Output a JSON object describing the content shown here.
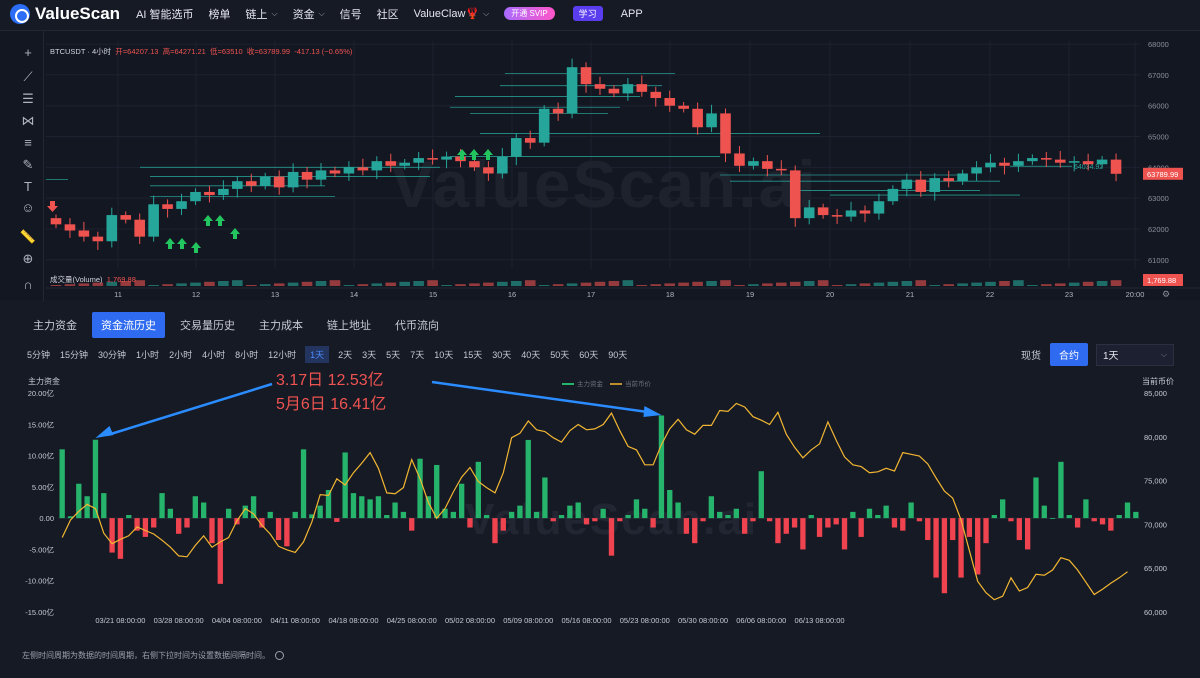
{
  "nav": {
    "brand": "ValueScan",
    "items": [
      "AI 智能选币",
      "榜单",
      "链上",
      "资金",
      "信号",
      "社区",
      "ValueClaw🦞"
    ],
    "vip_label": "开通 SVIP",
    "study_label": "学习",
    "app_label": "APP"
  },
  "kline": {
    "symbol": "BTCUSDT · 4小时",
    "open": "开=64207.13",
    "high": "高=64271.21",
    "low": "低=63510",
    "close": "收=63789.99",
    "change": "-417.13 (−0.65%)",
    "volume_label": "成交量(Volume)",
    "volume_value": "1,769.88",
    "price_ticks": [
      "68000",
      "67000",
      "66000",
      "65000",
      "64000",
      "63000",
      "62000",
      "61000"
    ],
    "date_ticks": [
      "11",
      "12",
      "13",
      "14",
      "15",
      "16",
      "17",
      "18",
      "19",
      "20",
      "21",
      "22",
      "23",
      "20:00"
    ],
    "last_price": "63789.99",
    "line_price": "64034.92",
    "watermark": "ValueScan.ai",
    "closes": [
      62150,
      61950,
      61750,
      61600,
      62450,
      62300,
      61750,
      62800,
      62650,
      62900,
      63200,
      63100,
      63300,
      63550,
      63400,
      63700,
      63350,
      63850,
      63600,
      63900,
      63800,
      64000,
      63900,
      64200,
      64050,
      64150,
      64300,
      64250,
      64350,
      64200,
      64000,
      63800,
      64350,
      64950,
      64800,
      65900,
      65750,
      67250,
      66700,
      66550,
      66400,
      66700,
      66450,
      66250,
      66000,
      65900,
      65300,
      65750,
      64450,
      64050,
      64200,
      63950,
      63900,
      62350,
      62700,
      62450,
      62400,
      62600,
      62500,
      62900,
      63300,
      63600,
      63200,
      63650,
      63550,
      63800,
      64000,
      64150,
      64050,
      64200,
      64300,
      64250,
      64150,
      64200,
      64100,
      64250,
      63790
    ],
    "colors": {
      "up": "#26a69a",
      "down": "#ef5350",
      "green": "#22c55e"
    }
  },
  "tabs": [
    "主力资金",
    "资金流历史",
    "交易量历史",
    "主力成本",
    "链上地址",
    "代币流向"
  ],
  "active_tab": 1,
  "intervals": [
    "5分钟",
    "15分钟",
    "30分钟",
    "1小时",
    "2小时",
    "4小时",
    "8小时",
    "12小时",
    "1天",
    "2天",
    "3天",
    "5天",
    "7天",
    "10天",
    "15天",
    "30天",
    "40天",
    "50天",
    "60天",
    "90天"
  ],
  "active_interval": 8,
  "market_types": [
    "现货",
    "合约"
  ],
  "active_market": 1,
  "period_select": "1天",
  "flow": {
    "left_title": "主力资金",
    "right_title": "当前币价",
    "legend": [
      "主力资金",
      "当前币价"
    ],
    "left_ticks": [
      "20.00亿",
      "15.00亿",
      "10.00亿",
      "5.00亿",
      "0.00",
      "-5.00亿",
      "-10.00亿",
      "-15.00亿"
    ],
    "right_ticks": [
      "85,000",
      "80,000",
      "75,000",
      "70,000",
      "65,000",
      "60,000"
    ],
    "x_ticks": [
      "03/21 08:00:00",
      "03/28 08:00:00",
      "04/04 08:00:00",
      "04/11 08:00:00",
      "04/18 08:00:00",
      "04/25 08:00:00",
      "05/02 08:00:00",
      "05/09 08:00:00",
      "05/16 08:00:00",
      "05/23 08:00:00",
      "05/30 08:00:00",
      "06/06 08:00:00",
      "06/13 08:00:00"
    ],
    "annotation_1": "3.17日   12.53亿",
    "annotation_2": "5月6日   16.41亿",
    "footer": "左侧时间周期为数据的时间周期，右侧下拉时间为设置数据间隔时间。",
    "watermark": "ValueScan.ai"
  },
  "chart_data": {
    "type": "bar",
    "x_range": [
      "03/14",
      "06/17"
    ],
    "series": [
      {
        "name": "主力资金",
        "unit": "亿",
        "values": [
          11,
          0.3,
          5.5,
          3.5,
          12.53,
          4,
          -5.5,
          -6.5,
          0.5,
          -2,
          -3,
          -1.5,
          4,
          1.5,
          -2.5,
          -1.5,
          3.5,
          2.5,
          -4,
          -10.5,
          1.5,
          -1,
          2,
          3.5,
          -1.5,
          1,
          -3.5,
          -4.5,
          1,
          11,
          0.6,
          2,
          4.5,
          -0.6,
          10.5,
          4,
          3.5,
          3,
          3.5,
          0.5,
          2.5,
          1,
          -2,
          9.5,
          3.5,
          8.5,
          1.5,
          1,
          5.5,
          -1.5,
          9,
          0.5,
          -4,
          -2,
          1,
          2,
          12.5,
          1,
          6.5,
          -0.5,
          0.5,
          2,
          2.5,
          -1,
          -0.5,
          1.5,
          -6,
          -0.5,
          0.5,
          3,
          1.5,
          -1.5,
          16.41,
          4.5,
          2.5,
          -2.5,
          -4,
          -0.5,
          3.5,
          1,
          0.5,
          1.5,
          -2.5,
          -0.5,
          7.5,
          -0.5,
          -4,
          -2.5,
          -1.5,
          -5,
          0.5,
          -3,
          -1.5,
          -1,
          -5,
          1,
          -3,
          1.5,
          0.5,
          2,
          -1.5,
          -2,
          2.5,
          -0.5,
          -3.5,
          -9.5,
          -12,
          -3.5,
          -9.5,
          -3,
          -9,
          -4,
          0.5,
          3,
          -0.5,
          -3.5,
          -5,
          6.5,
          2,
          0,
          9,
          0.5,
          -1.5,
          3,
          -0.5,
          -1,
          -2,
          0.5,
          2.5,
          1
        ]
      },
      {
        "name": "当前币价",
        "unit": "USD",
        "values": [
          68500,
          70500,
          71500,
          72300,
          71800,
          69000,
          67800,
          68300,
          68700,
          69700,
          69300,
          68900,
          68200,
          67400,
          66400,
          66300,
          67600,
          68700,
          67400,
          68000,
          68500,
          70400,
          71800,
          71200,
          69900,
          68900,
          67500,
          67100,
          66800,
          68000,
          70300,
          73400,
          73300,
          75200,
          74500,
          75900,
          77000,
          78200,
          76400,
          73600,
          73500,
          74200,
          77400,
          75200,
          72500,
          70700,
          71800,
          73700,
          75400,
          76500,
          74900,
          74200,
          73600,
          75900,
          79900,
          80400,
          81800,
          80800,
          80600,
          79900,
          79400,
          80700,
          81400,
          80800,
          80900,
          81400,
          82700,
          80700,
          78900,
          78500,
          76800,
          76800,
          79100,
          80900,
          82000,
          80800,
          80300,
          81300,
          81300,
          83000,
          82900,
          83800,
          83400,
          82300,
          81900,
          81400,
          82800,
          80300,
          78800,
          77600,
          78500,
          79200,
          81700,
          79600,
          77700,
          76800,
          76600,
          75900,
          76000,
          76400,
          76100,
          78200,
          78000,
          77800,
          76900,
          75300,
          73800,
          73000,
          70500,
          67000,
          63500,
          62200,
          61400,
          61800,
          63900,
          62400,
          62800,
          64300,
          64200,
          64800,
          66200,
          65900,
          64800,
          63400,
          62000,
          62600,
          63300,
          63900,
          64600
        ]
      }
    ],
    "ylim_left": [
      -15,
      20
    ],
    "ylim_right": [
      60000,
      85000
    ],
    "legend_position": "top-center"
  }
}
